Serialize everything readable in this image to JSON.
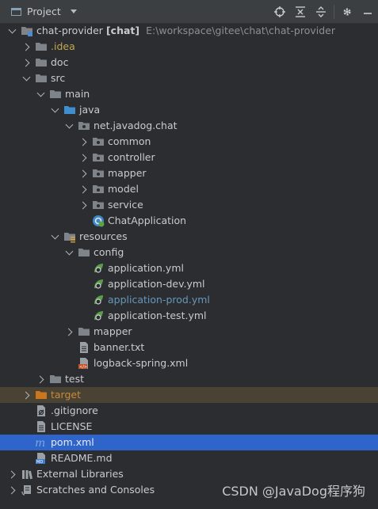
{
  "header": {
    "title": "Project",
    "icons": [
      "locate-icon",
      "collapse-all-icon",
      "expand-all-icon",
      "gear-icon",
      "hide-icon"
    ]
  },
  "tree": [
    {
      "label": "chat-provider",
      "suffix": "[chat]",
      "path": "E:\\workspace\\gitee\\chat\\chat-provider",
      "icon": "module-folder",
      "depth": 0,
      "expanded": true
    },
    {
      "label": ".idea",
      "icon": "folder",
      "depth": 1,
      "expanded": false,
      "color": "#c2a74f"
    },
    {
      "label": "doc",
      "icon": "folder",
      "depth": 1,
      "expanded": false
    },
    {
      "label": "src",
      "icon": "folder",
      "depth": 1,
      "expanded": true
    },
    {
      "label": "main",
      "icon": "folder",
      "depth": 2,
      "expanded": true
    },
    {
      "label": "java",
      "icon": "source-folder",
      "depth": 3,
      "expanded": true
    },
    {
      "label": "net.javadog.chat",
      "icon": "package",
      "depth": 4,
      "expanded": true
    },
    {
      "label": "common",
      "icon": "package",
      "depth": 5,
      "expanded": false
    },
    {
      "label": "controller",
      "icon": "package",
      "depth": 5,
      "expanded": false
    },
    {
      "label": "mapper",
      "icon": "package",
      "depth": 5,
      "expanded": false
    },
    {
      "label": "model",
      "icon": "package",
      "depth": 5,
      "expanded": false
    },
    {
      "label": "service",
      "icon": "package",
      "depth": 5,
      "expanded": false
    },
    {
      "label": "ChatApplication",
      "icon": "spring-class",
      "depth": 5,
      "leaf": true
    },
    {
      "label": "resources",
      "icon": "resources-folder",
      "depth": 3,
      "expanded": true
    },
    {
      "label": "config",
      "icon": "folder",
      "depth": 4,
      "expanded": true
    },
    {
      "label": "application.yml",
      "icon": "spring-yml",
      "depth": 5,
      "leaf": true
    },
    {
      "label": "application-dev.yml",
      "icon": "spring-yml",
      "depth": 5,
      "leaf": true
    },
    {
      "label": "application-prod.yml",
      "icon": "spring-yml",
      "depth": 5,
      "leaf": true,
      "color": "#6897bb"
    },
    {
      "label": "application-test.yml",
      "icon": "spring-yml",
      "depth": 5,
      "leaf": true
    },
    {
      "label": "mapper",
      "icon": "folder",
      "depth": 4,
      "expanded": false
    },
    {
      "label": "banner.txt",
      "icon": "text-file",
      "depth": 4,
      "leaf": true
    },
    {
      "label": "logback-spring.xml",
      "icon": "xml-file",
      "depth": 4,
      "leaf": true
    },
    {
      "label": "test",
      "icon": "folder",
      "depth": 2,
      "expanded": false
    },
    {
      "label": "target",
      "icon": "excluded-folder",
      "depth": 1,
      "expanded": false,
      "color": "#c78a3c",
      "excluded": true
    },
    {
      "label": ".gitignore",
      "icon": "gitignore-file",
      "depth": 1,
      "leaf": true
    },
    {
      "label": "LICENSE",
      "icon": "text-file",
      "depth": 1,
      "leaf": true
    },
    {
      "label": "pom.xml",
      "icon": "maven-file",
      "depth": 1,
      "leaf": true,
      "selected": true,
      "color": "#e8eaee"
    },
    {
      "label": "README.md",
      "icon": "markdown-file",
      "depth": 1,
      "leaf": true
    },
    {
      "label": "External Libraries",
      "icon": "libraries",
      "depth": 0,
      "expanded": false
    },
    {
      "label": "Scratches and Consoles",
      "icon": "scratches",
      "depth": 0,
      "expanded": false
    }
  ],
  "watermark": "CSDN @JavaDog程序狗",
  "colors": {
    "background": "#2b2d30",
    "selection": "#2f65ca",
    "excluded_row": "#4a4334",
    "text": "#c9cbd0"
  }
}
